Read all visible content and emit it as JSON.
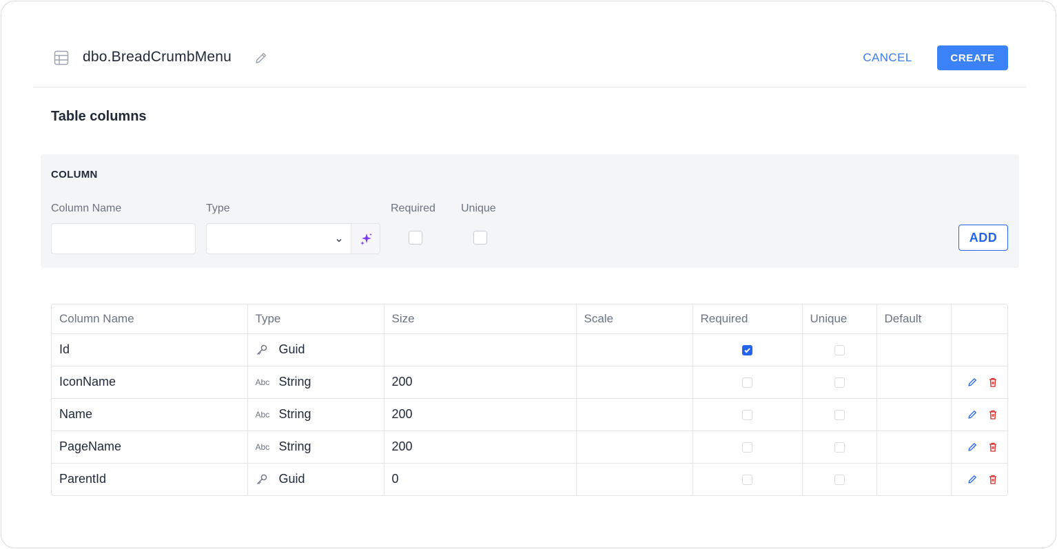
{
  "header": {
    "table_icon": "table-grid-icon",
    "title": "dbo.BreadCrumbMenu",
    "edit_icon": "pencil-icon",
    "cancel_label": "CANCEL",
    "create_label": "CREATE",
    "accent_color": "#3b82f6"
  },
  "section_title": "Table columns",
  "panel": {
    "heading": "COLUMN",
    "column_name_label": "Column Name",
    "column_name_value": "",
    "type_label": "Type",
    "type_value": "",
    "magic_icon": "sparkles-icon",
    "required_label": "Required",
    "required_checked": false,
    "unique_label": "Unique",
    "unique_checked": false,
    "add_label": "ADD"
  },
  "table": {
    "headers": [
      "Column Name",
      "Type",
      "Size",
      "Scale",
      "Required",
      "Unique",
      "Default",
      ""
    ],
    "rows": [
      {
        "name": "Id",
        "type_icon": "key-icon",
        "type": "Guid",
        "size": "",
        "scale": "",
        "required": true,
        "unique": false,
        "default": "",
        "editable": false
      },
      {
        "name": "IconName",
        "type_icon": "abc-icon",
        "type": "String",
        "size": "200",
        "scale": "",
        "required": false,
        "unique": false,
        "default": "",
        "editable": true
      },
      {
        "name": "Name",
        "type_icon": "abc-icon",
        "type": "String",
        "size": "200",
        "scale": "",
        "required": false,
        "unique": false,
        "default": "",
        "editable": true
      },
      {
        "name": "PageName",
        "type_icon": "abc-icon",
        "type": "String",
        "size": "200",
        "scale": "",
        "required": false,
        "unique": false,
        "default": "",
        "editable": true
      },
      {
        "name": "ParentId",
        "type_icon": "key-icon",
        "type": "Guid",
        "size": "0",
        "scale": "",
        "required": false,
        "unique": false,
        "default": "",
        "editable": true
      }
    ],
    "abc_glyph": "Abc"
  }
}
